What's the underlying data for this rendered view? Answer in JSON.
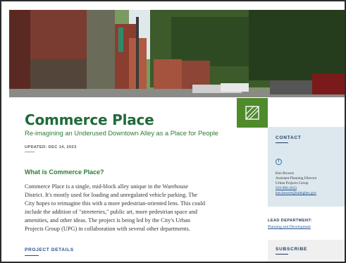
{
  "hero": {
    "icon": "alley-photo"
  },
  "logo": {
    "icon": "commerce-place-logo-icon",
    "color": "#4f8a2b"
  },
  "page": {
    "title": "Commerce Place",
    "subtitle": "Re-imagining an Underused Downtown Alley as a Place for People",
    "updated": "UPDATED: DEC 14, 2023"
  },
  "section": {
    "heading": "What is Commerce Place?",
    "lines": [
      "Commerce Place is a single, mid-block alley unique in the Warehouse",
      "District. It's mostly used for loading and unregulated vehicle parking. The",
      "City hopes to reimagine this with a more pedestrian-oriented lens. This could",
      "include the addition of \"streeteries,\" public art, more pedestrian space and",
      "amenities, and other ideas. The project is being led by the City's Urban",
      "Projects Group (UPG) in collaboration with several other departments."
    ]
  },
  "project_details": {
    "heading": "PROJECT DETAILS"
  },
  "contact": {
    "heading": "CONTACT",
    "name": "Ken Bowers",
    "role": "Assistant Planning Director",
    "group": "Urban Projects Group",
    "phone": "919-996-2633",
    "email": "ken.bowers@raleighnc.gov"
  },
  "lead": {
    "heading": "LEAD DEPARTMENT:",
    "department": "Planning and Development"
  },
  "subscribe": {
    "heading": "SUBSCRIBE"
  },
  "colors": {
    "accent_green": "#1f6b3a",
    "link_blue": "#1f4f8a",
    "contact_bg": "#dce8ee"
  }
}
